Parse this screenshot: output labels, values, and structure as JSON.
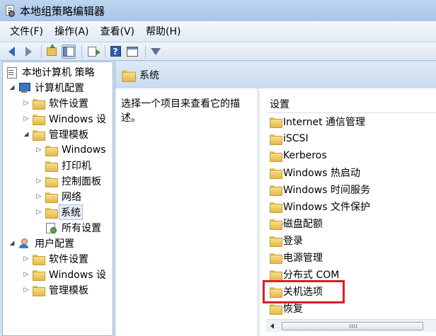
{
  "window": {
    "title": "本地组策略编辑器"
  },
  "menu": [
    {
      "label": "文件(F)"
    },
    {
      "label": "操作(A)"
    },
    {
      "label": "查看(V)"
    },
    {
      "label": "帮助(H)"
    }
  ],
  "toolbar": {
    "buttons": [
      "back-arrow-icon",
      "forward-arrow-icon",
      "up-folder-icon",
      "show-hide-pane-icon",
      "export-list-icon",
      "help-icon",
      "properties-icon",
      "filter-icon"
    ]
  },
  "tree": [
    {
      "label": "本地计算机 策略"
    },
    {
      "label": "计算机配置"
    },
    {
      "label": "软件设置"
    },
    {
      "label": "Windows 设"
    },
    {
      "label": "管理模板"
    },
    {
      "label": "Windows"
    },
    {
      "label": "打印机"
    },
    {
      "label": "控制面板"
    },
    {
      "label": "网络"
    },
    {
      "label": "系统"
    },
    {
      "label": "所有设置"
    },
    {
      "label": "用户配置"
    },
    {
      "label": "软件设置"
    },
    {
      "label": "Windows 设"
    },
    {
      "label": "管理模板"
    }
  ],
  "right": {
    "header_title": "系统",
    "description": "选择一个项目来查看它的描述。",
    "list_header": "设置",
    "items": [
      {
        "label": "Internet 通信管理"
      },
      {
        "label": "iSCSI"
      },
      {
        "label": "Kerberos"
      },
      {
        "label": "Windows 热启动"
      },
      {
        "label": "Windows 时间服务"
      },
      {
        "label": "Windows 文件保护"
      },
      {
        "label": "磁盘配额"
      },
      {
        "label": "登录"
      },
      {
        "label": "电源管理"
      },
      {
        "label": "分布式 COM"
      },
      {
        "label": "关机选项"
      },
      {
        "label": "恢复"
      }
    ]
  },
  "colors": {
    "highlight": "#d4202a",
    "accent": "#2b66b8"
  }
}
